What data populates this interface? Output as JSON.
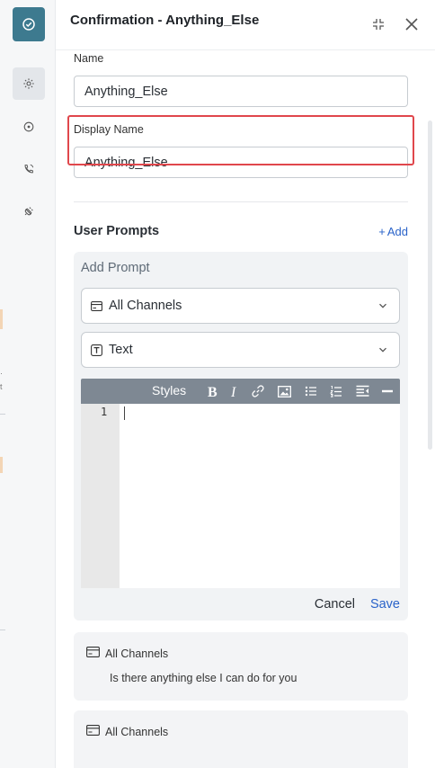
{
  "window": {
    "title": "Confirmation - Anything_Else"
  },
  "fields": {
    "name_label": "Name",
    "name_value": "Anything_Else",
    "display_name_label": "Display Name",
    "display_name_value": "Anything_Else"
  },
  "user_prompts": {
    "title": "User Prompts",
    "add_label": "Add",
    "add_prompt": {
      "heading": "Add Prompt",
      "channel_select": "All Channels",
      "type_select": "Text",
      "toolbar": {
        "styles_label": "Styles",
        "tools": [
          "bold",
          "italic",
          "link",
          "image",
          "bulleted-list",
          "numbered-list",
          "indent",
          "horizontal-rule"
        ]
      },
      "editor": {
        "line_number": "1",
        "content": ""
      },
      "cancel_label": "Cancel",
      "save_label": "Save"
    },
    "prompts": [
      {
        "channel": "All Channels",
        "text": "Is there anything else I can do for you"
      },
      {
        "channel": "All Channels",
        "text": ""
      }
    ]
  },
  "icons": {
    "rail_logo": "check-circle-icon",
    "rail_items": [
      "gear-icon",
      "target-icon",
      "phone-icon",
      "plug-icon"
    ],
    "header": [
      "collapse-icon",
      "close-icon"
    ],
    "channel": "card-icon",
    "type": "text-box-icon"
  },
  "colors": {
    "accent": "#2a63c9",
    "rail_logo": "#3d7a8f",
    "toolbar": "#7e8893",
    "highlight": "#e0474c"
  }
}
